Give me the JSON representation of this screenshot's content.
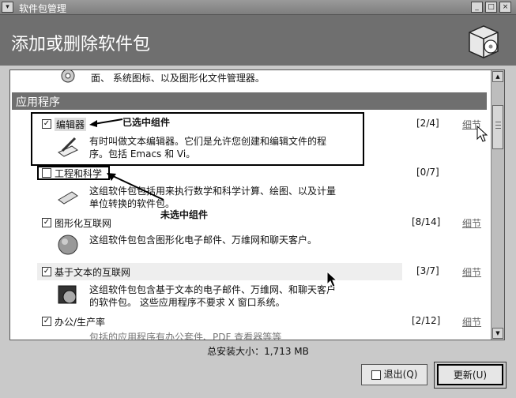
{
  "window": {
    "title": "软件包管理"
  },
  "header": {
    "title": "添加或删除软件包"
  },
  "partial_top": {
    "desc": "面、 系统图标、以及图形化文件管理器。"
  },
  "section": {
    "title": "应用程序"
  },
  "groups": [
    {
      "label": "编辑器",
      "checked": true,
      "count": "[2/4]",
      "detail": "细节",
      "desc1": "有时叫做文本编辑器。它们是允许您创建和编辑文件的程",
      "desc2": "序。包括 Emacs 和 Vi。"
    },
    {
      "label": "工程和科学",
      "checked": false,
      "count": "[0/7]",
      "detail": "",
      "desc1": "这组软件包包括用来执行数学和科学计算、绘图、以及计量",
      "desc2": "单位转换的软件包。"
    },
    {
      "label": "图形化互联网",
      "checked": true,
      "count": "[8/14]",
      "detail": "细节",
      "desc1": "这组软件包包含图形化电子邮件、万维网和聊天客户。",
      "desc2": ""
    },
    {
      "label": "基于文本的互联网",
      "checked": true,
      "count": "[3/7]",
      "detail": "细节",
      "desc1": "这组软件包包含基于文本的电子邮件、万维网、和聊天客户",
      "desc2": "的软件包。 这些应用程序不要求 X 窗口系统。"
    },
    {
      "label": "办公/生产率",
      "checked": true,
      "count": "[2/12]",
      "detail": "细节",
      "desc1": "包括的应用程序有办公套件、PDF 查看器等等",
      "desc2": ""
    }
  ],
  "annotations": {
    "selected": "已选中组件",
    "unselected": "未选中组件"
  },
  "footer": {
    "total": "总安装大小：1,713 MB"
  },
  "buttons": {
    "quit": "退出(Q)",
    "update": "更新(U)"
  },
  "glyphs": {
    "check": "✓",
    "menu": "▾",
    "min": "_",
    "max": "□",
    "close": "×",
    "up": "▲",
    "down": "▼"
  }
}
